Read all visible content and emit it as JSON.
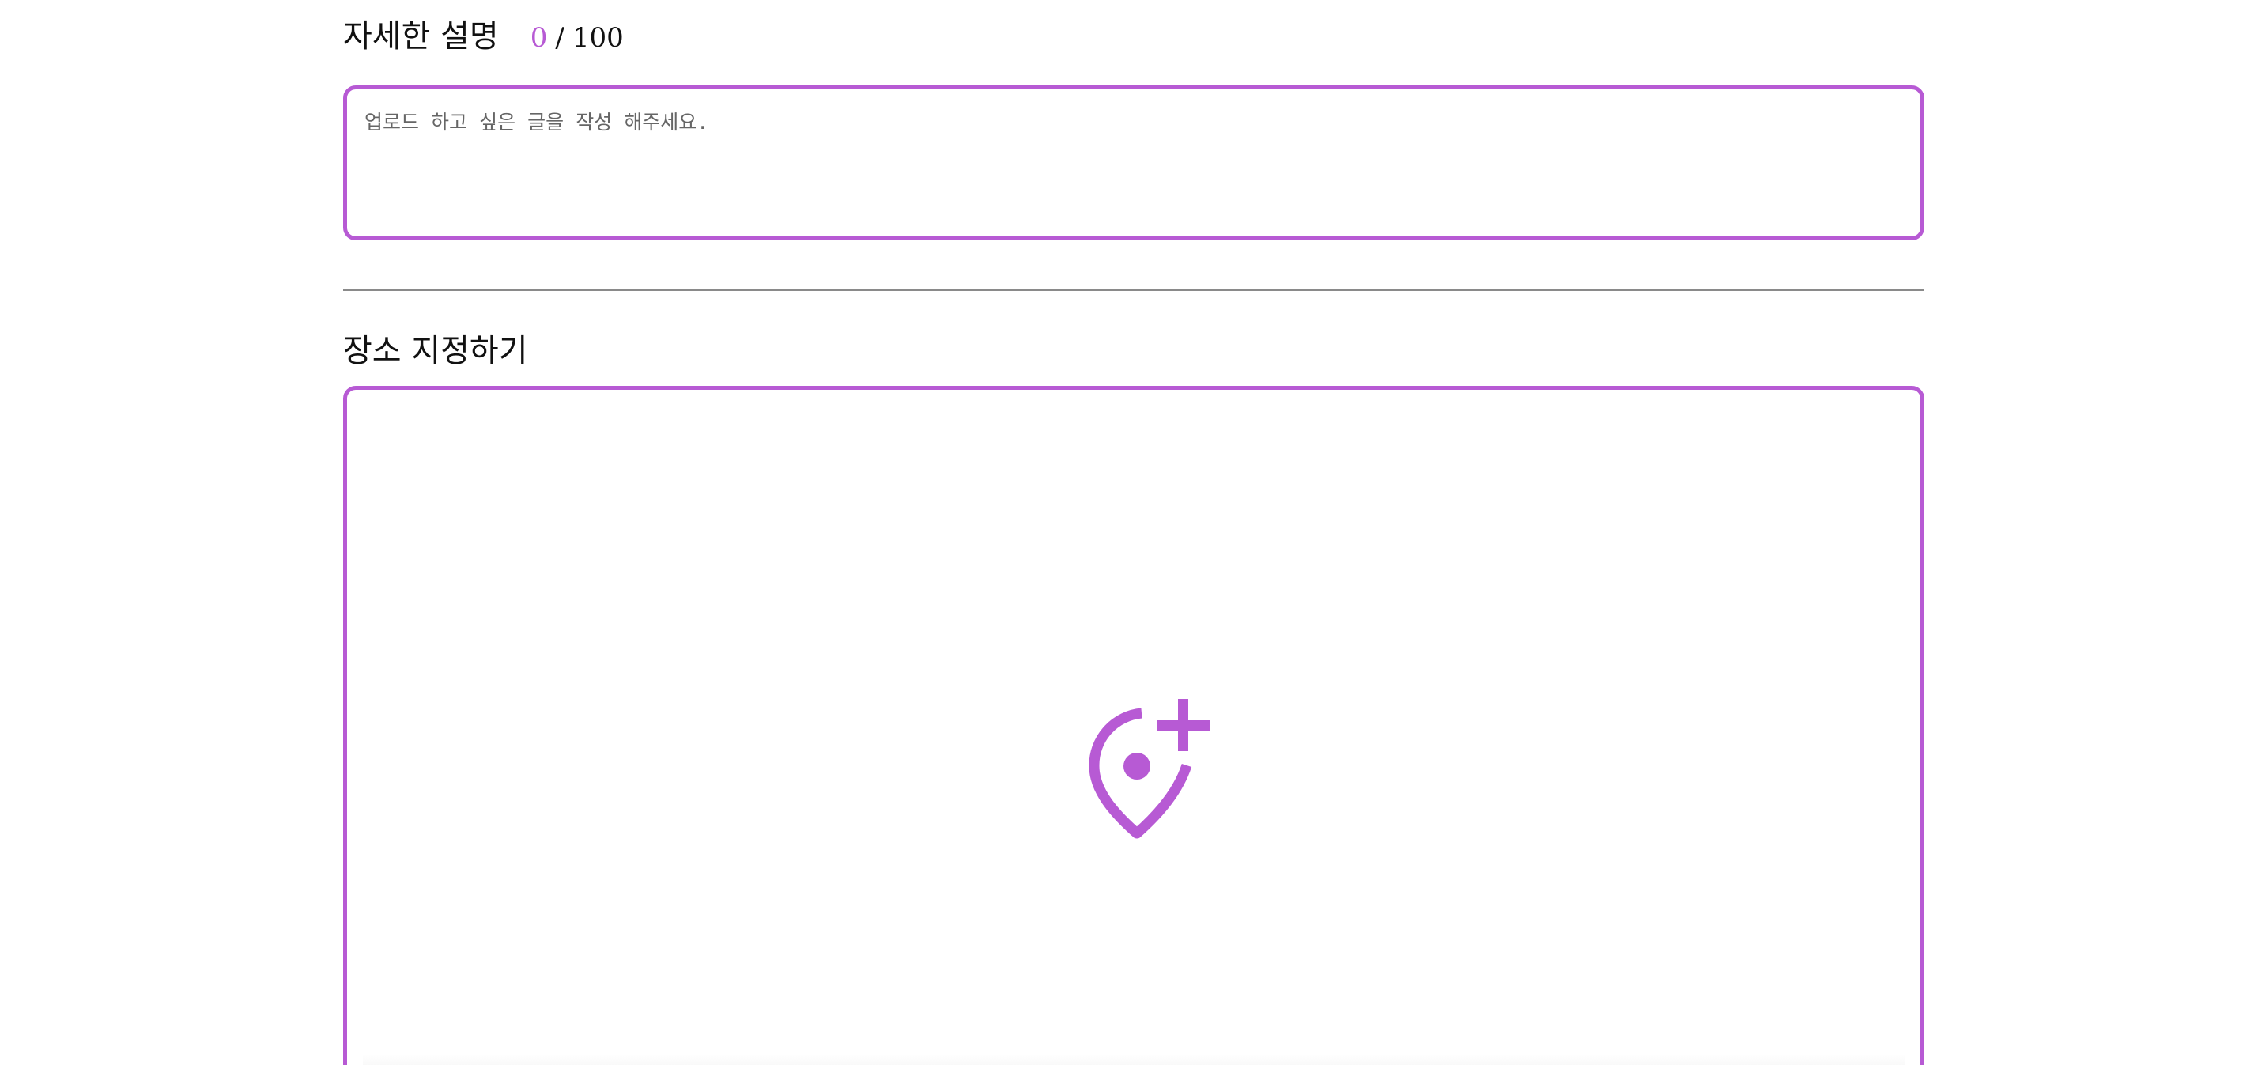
{
  "description_section": {
    "title": "자세한 설명",
    "counter_current": "0",
    "counter_separator": "/",
    "counter_max": "100",
    "placeholder": "업로드 하고 싶은 글을 작성 해주세요."
  },
  "place_section": {
    "title": "장소 지정하기",
    "icon": "add-location-icon"
  },
  "colors": {
    "accent": "#b75ad4",
    "divider": "#8a8a8a",
    "text": "#111111",
    "placeholder": "#666666"
  }
}
